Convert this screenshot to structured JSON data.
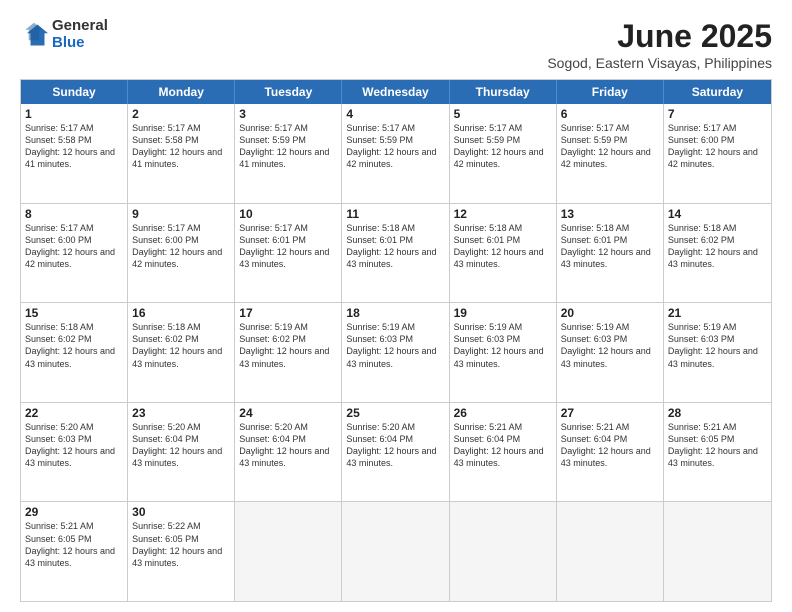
{
  "header": {
    "logo": {
      "general": "General",
      "blue": "Blue"
    },
    "title": "June 2025",
    "subtitle": "Sogod, Eastern Visayas, Philippines"
  },
  "calendar": {
    "days_of_week": [
      "Sunday",
      "Monday",
      "Tuesday",
      "Wednesday",
      "Thursday",
      "Friday",
      "Saturday"
    ],
    "weeks": [
      [
        {
          "day": "1",
          "sunrise": "5:17 AM",
          "sunset": "5:58 PM",
          "daylight": "12 hours and 41 minutes."
        },
        {
          "day": "2",
          "sunrise": "5:17 AM",
          "sunset": "5:58 PM",
          "daylight": "12 hours and 41 minutes."
        },
        {
          "day": "3",
          "sunrise": "5:17 AM",
          "sunset": "5:59 PM",
          "daylight": "12 hours and 41 minutes."
        },
        {
          "day": "4",
          "sunrise": "5:17 AM",
          "sunset": "5:59 PM",
          "daylight": "12 hours and 42 minutes."
        },
        {
          "day": "5",
          "sunrise": "5:17 AM",
          "sunset": "5:59 PM",
          "daylight": "12 hours and 42 minutes."
        },
        {
          "day": "6",
          "sunrise": "5:17 AM",
          "sunset": "5:59 PM",
          "daylight": "12 hours and 42 minutes."
        },
        {
          "day": "7",
          "sunrise": "5:17 AM",
          "sunset": "6:00 PM",
          "daylight": "12 hours and 42 minutes."
        }
      ],
      [
        {
          "day": "8",
          "sunrise": "5:17 AM",
          "sunset": "6:00 PM",
          "daylight": "12 hours and 42 minutes."
        },
        {
          "day": "9",
          "sunrise": "5:17 AM",
          "sunset": "6:00 PM",
          "daylight": "12 hours and 42 minutes."
        },
        {
          "day": "10",
          "sunrise": "5:17 AM",
          "sunset": "6:01 PM",
          "daylight": "12 hours and 43 minutes."
        },
        {
          "day": "11",
          "sunrise": "5:18 AM",
          "sunset": "6:01 PM",
          "daylight": "12 hours and 43 minutes."
        },
        {
          "day": "12",
          "sunrise": "5:18 AM",
          "sunset": "6:01 PM",
          "daylight": "12 hours and 43 minutes."
        },
        {
          "day": "13",
          "sunrise": "5:18 AM",
          "sunset": "6:01 PM",
          "daylight": "12 hours and 43 minutes."
        },
        {
          "day": "14",
          "sunrise": "5:18 AM",
          "sunset": "6:02 PM",
          "daylight": "12 hours and 43 minutes."
        }
      ],
      [
        {
          "day": "15",
          "sunrise": "5:18 AM",
          "sunset": "6:02 PM",
          "daylight": "12 hours and 43 minutes."
        },
        {
          "day": "16",
          "sunrise": "5:18 AM",
          "sunset": "6:02 PM",
          "daylight": "12 hours and 43 minutes."
        },
        {
          "day": "17",
          "sunrise": "5:19 AM",
          "sunset": "6:02 PM",
          "daylight": "12 hours and 43 minutes."
        },
        {
          "day": "18",
          "sunrise": "5:19 AM",
          "sunset": "6:03 PM",
          "daylight": "12 hours and 43 minutes."
        },
        {
          "day": "19",
          "sunrise": "5:19 AM",
          "sunset": "6:03 PM",
          "daylight": "12 hours and 43 minutes."
        },
        {
          "day": "20",
          "sunrise": "5:19 AM",
          "sunset": "6:03 PM",
          "daylight": "12 hours and 43 minutes."
        },
        {
          "day": "21",
          "sunrise": "5:19 AM",
          "sunset": "6:03 PM",
          "daylight": "12 hours and 43 minutes."
        }
      ],
      [
        {
          "day": "22",
          "sunrise": "5:20 AM",
          "sunset": "6:03 PM",
          "daylight": "12 hours and 43 minutes."
        },
        {
          "day": "23",
          "sunrise": "5:20 AM",
          "sunset": "6:04 PM",
          "daylight": "12 hours and 43 minutes."
        },
        {
          "day": "24",
          "sunrise": "5:20 AM",
          "sunset": "6:04 PM",
          "daylight": "12 hours and 43 minutes."
        },
        {
          "day": "25",
          "sunrise": "5:20 AM",
          "sunset": "6:04 PM",
          "daylight": "12 hours and 43 minutes."
        },
        {
          "day": "26",
          "sunrise": "5:21 AM",
          "sunset": "6:04 PM",
          "daylight": "12 hours and 43 minutes."
        },
        {
          "day": "27",
          "sunrise": "5:21 AM",
          "sunset": "6:04 PM",
          "daylight": "12 hours and 43 minutes."
        },
        {
          "day": "28",
          "sunrise": "5:21 AM",
          "sunset": "6:05 PM",
          "daylight": "12 hours and 43 minutes."
        }
      ],
      [
        {
          "day": "29",
          "sunrise": "5:21 AM",
          "sunset": "6:05 PM",
          "daylight": "12 hours and 43 minutes."
        },
        {
          "day": "30",
          "sunrise": "5:22 AM",
          "sunset": "6:05 PM",
          "daylight": "12 hours and 43 minutes."
        },
        null,
        null,
        null,
        null,
        null
      ]
    ],
    "labels": {
      "sunrise": "Sunrise:",
      "sunset": "Sunset:",
      "daylight": "Daylight:"
    }
  }
}
